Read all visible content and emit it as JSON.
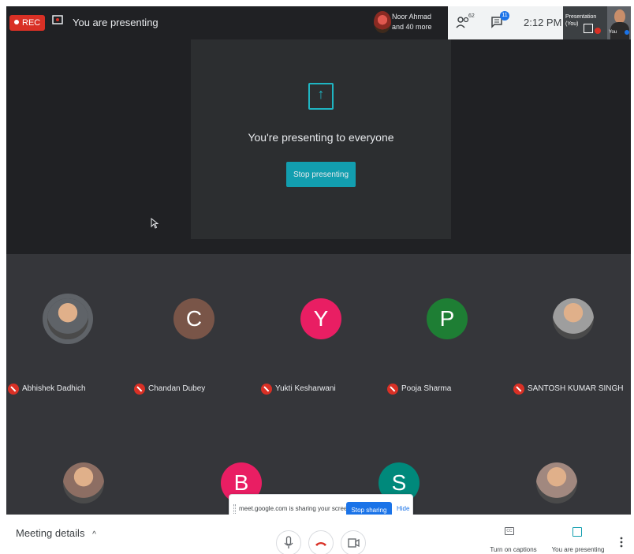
{
  "topbar": {
    "rec_label": "REC",
    "presenting_title": "You are presenting",
    "speaker": {
      "line1": "Noor Ahmad",
      "line2": "and 40 more"
    },
    "people_count": "62",
    "chat_badge": "11",
    "time": "2:12 PM",
    "thumb_presentation_label": "Presentation (You)",
    "thumb_you_label": "You"
  },
  "presenting_panel": {
    "heading": "You're presenting to everyone",
    "stop_button": "Stop presenting"
  },
  "participants": [
    {
      "name": "Abhishek Dadhich",
      "initial": "",
      "color": "#5f6368",
      "photo": true
    },
    {
      "name": "Chandan Dubey",
      "initial": "C",
      "color": "#795548",
      "photo": false
    },
    {
      "name": "Yukti Kesharwani",
      "initial": "Y",
      "color": "#e91e63",
      "photo": false
    },
    {
      "name": "Pooja Sharma",
      "initial": "P",
      "color": "#1e7e34",
      "photo": false
    },
    {
      "name": "SANTOSH KUMAR SINGH",
      "initial": "",
      "color": "#9e9e9e",
      "photo": true
    },
    {
      "name": "",
      "initial": "",
      "color": "#8d6e63",
      "photo": true
    },
    {
      "name": "",
      "initial": "B",
      "color": "#e91e63",
      "photo": false
    },
    {
      "name": "",
      "initial": "S",
      "color": "#00897b",
      "photo": false
    },
    {
      "name": "",
      "initial": "",
      "color": "#a1887f",
      "photo": true
    }
  ],
  "share_banner": {
    "text": "meet.google.com is sharing your screen.",
    "stop_button": "Stop sharing",
    "hide_link": "Hide"
  },
  "bottombar": {
    "meeting_details": "Meeting details",
    "captions_label": "Turn on captions",
    "presenting_label": "You are presenting"
  },
  "colors": {
    "accent_teal": "#129eaf",
    "danger_red": "#d93025",
    "primary_blue": "#1a73e8",
    "dark_bg": "#202124"
  }
}
